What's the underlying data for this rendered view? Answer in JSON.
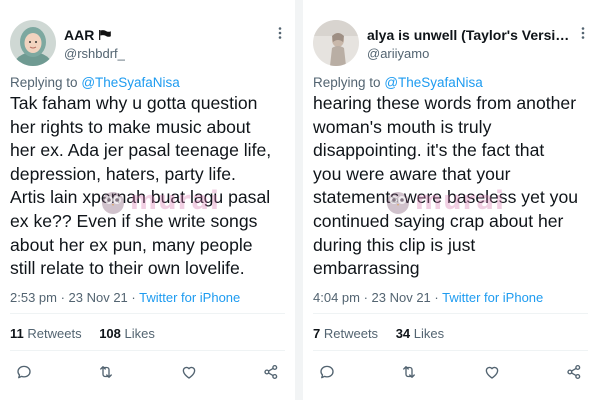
{
  "tweets": [
    {
      "display_name": "AAR",
      "handle": "@rshbdrf_",
      "replying_prefix": "Replying to",
      "replying_to": "@TheSyafaNisa",
      "text": "Tak faham why u gotta question\nher rights to make music about\nher ex. Ada jer pasal teenage life,\ndepression, haters, party life.\nArtis lain xpernah buat lagu pasal\nex ke?? Even if she write songs\nabout her ex pun, many people\nstill relate to their own lovelife.",
      "time": "2:53 pm · 23 Nov 21 · ",
      "source": "Twitter for iPhone",
      "retweets_count": "11",
      "retweets_label": "Retweets",
      "likes_count": "108",
      "likes_label": "Likes",
      "flag_icon": "black-flag-emoji"
    },
    {
      "display_name": "alya is unwell (Taylor's Version...",
      "handle": "@ariiyamo",
      "replying_prefix": "Replying to",
      "replying_to": "@TheSyafaNisa",
      "text": "hearing these words from another\nwoman's mouth is truly\ndisappointing. it's the fact that\nyou were aware that your\nstatements were baseless yet you\ncontinued saying crap about her\nduring this clip is just\nembarrassing",
      "time": "4:04 pm · 23 Nov 21 · ",
      "source": "Twitter for iPhone",
      "retweets_count": "7",
      "retweets_label": "Retweets",
      "likes_count": "34",
      "likes_label": "Likes"
    }
  ],
  "watermark": {
    "text": "murai",
    "color": "#d678af"
  },
  "colors": {
    "link": "#1d9bf0",
    "secondary": "#536471",
    "text": "#0f1419"
  },
  "icons": [
    "more-icon",
    "reply-icon",
    "retweet-icon",
    "like-icon",
    "share-icon"
  ]
}
